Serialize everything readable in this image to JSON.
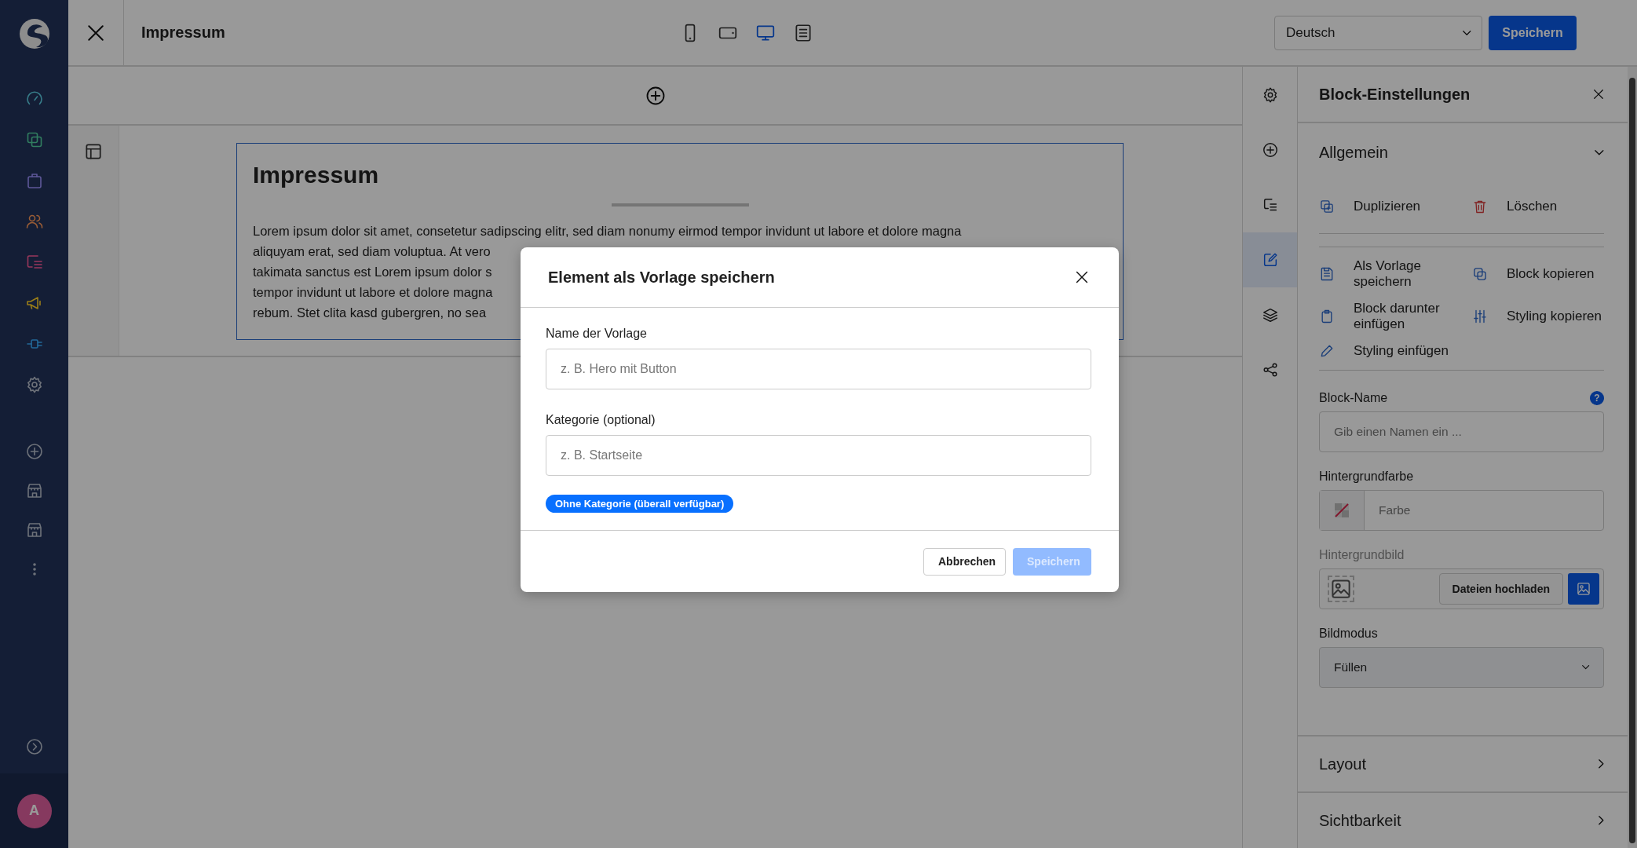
{
  "nav": {
    "avatar": "A"
  },
  "toolbar": {
    "title": "Impressum",
    "devices": [
      {
        "kind": "mobile",
        "selected": false
      },
      {
        "kind": "tablet",
        "selected": false
      },
      {
        "kind": "desktop",
        "selected": true
      },
      {
        "kind": "list",
        "selected": false
      }
    ],
    "language": "Deutsch",
    "save": "Speichern"
  },
  "canvas": {
    "block": {
      "heading": "Impressum",
      "lines": [
        "Lorem ipsum dolor sit amet, consetetur sadipscing elitr, sed diam nonumy eirmod tempor invidunt ut labore et dolore magna",
        "aliquyam erat, sed diam voluptua. At vero",
        "takimata sanctus est Lorem ipsum dolor s",
        "tempor invidunt ut labore et dolore magna",
        "rebum. Stet clita kasd gubergren, no sea"
      ]
    }
  },
  "rail": [
    {
      "kind": "settings",
      "selected": false
    },
    {
      "kind": "add",
      "selected": false
    },
    {
      "kind": "list",
      "selected": false
    },
    {
      "kind": "edit",
      "selected": true
    },
    {
      "kind": "layers",
      "selected": false
    },
    {
      "kind": "share",
      "selected": false
    }
  ],
  "panel": {
    "title": "Block-Einstellungen",
    "sections": [
      {
        "title": "Allgemein",
        "expanded": true
      },
      {
        "title": "Layout",
        "expanded": false
      },
      {
        "title": "Sichtbarkeit",
        "expanded": false
      }
    ],
    "actions": [
      [
        {
          "kind": "duplicate",
          "label": "Duplizieren"
        },
        {
          "kind": "delete",
          "label": "Löschen"
        }
      ],
      [
        {
          "kind": "save",
          "label": "Als Vorlage speichern"
        },
        {
          "kind": "copy",
          "label": "Block kopieren"
        },
        {
          "kind": "paste",
          "label": "Block darunter einfügen"
        },
        {
          "kind": "sliders",
          "label": "Styling kopieren"
        },
        {
          "kind": "pencil",
          "label": "Styling einfügen"
        }
      ]
    ],
    "fields": [
      {
        "kind": "text",
        "label": "Block-Name",
        "help": "?",
        "placeholder": "Gib einen Namen ein ...",
        "disabled": false
      },
      {
        "kind": "color",
        "label": "Hintergrundfarbe",
        "placeholder": "Farbe",
        "disabled": false
      },
      {
        "kind": "image",
        "label": "Hintergrundbild",
        "button": "Dateien hochladen",
        "disabled": true
      },
      {
        "kind": "select",
        "label": "Bildmodus",
        "value": "Füllen",
        "disabled": false
      }
    ]
  },
  "modal": {
    "title": "Element als Vorlage speichern",
    "fields": [
      {
        "label": "Name der Vorlage",
        "placeholder": "z. B. Hero mit Button"
      },
      {
        "label": "Kategorie (optional)",
        "placeholder": "z. B. Startseite"
      }
    ],
    "tag": "Ohne Kategorie (überall verfügbar)",
    "buttons": [
      {
        "kind": "cancel",
        "label": "Abbrechen",
        "disabled": false
      },
      {
        "kind": "save",
        "label": "Speichern",
        "disabled": true
      }
    ]
  }
}
